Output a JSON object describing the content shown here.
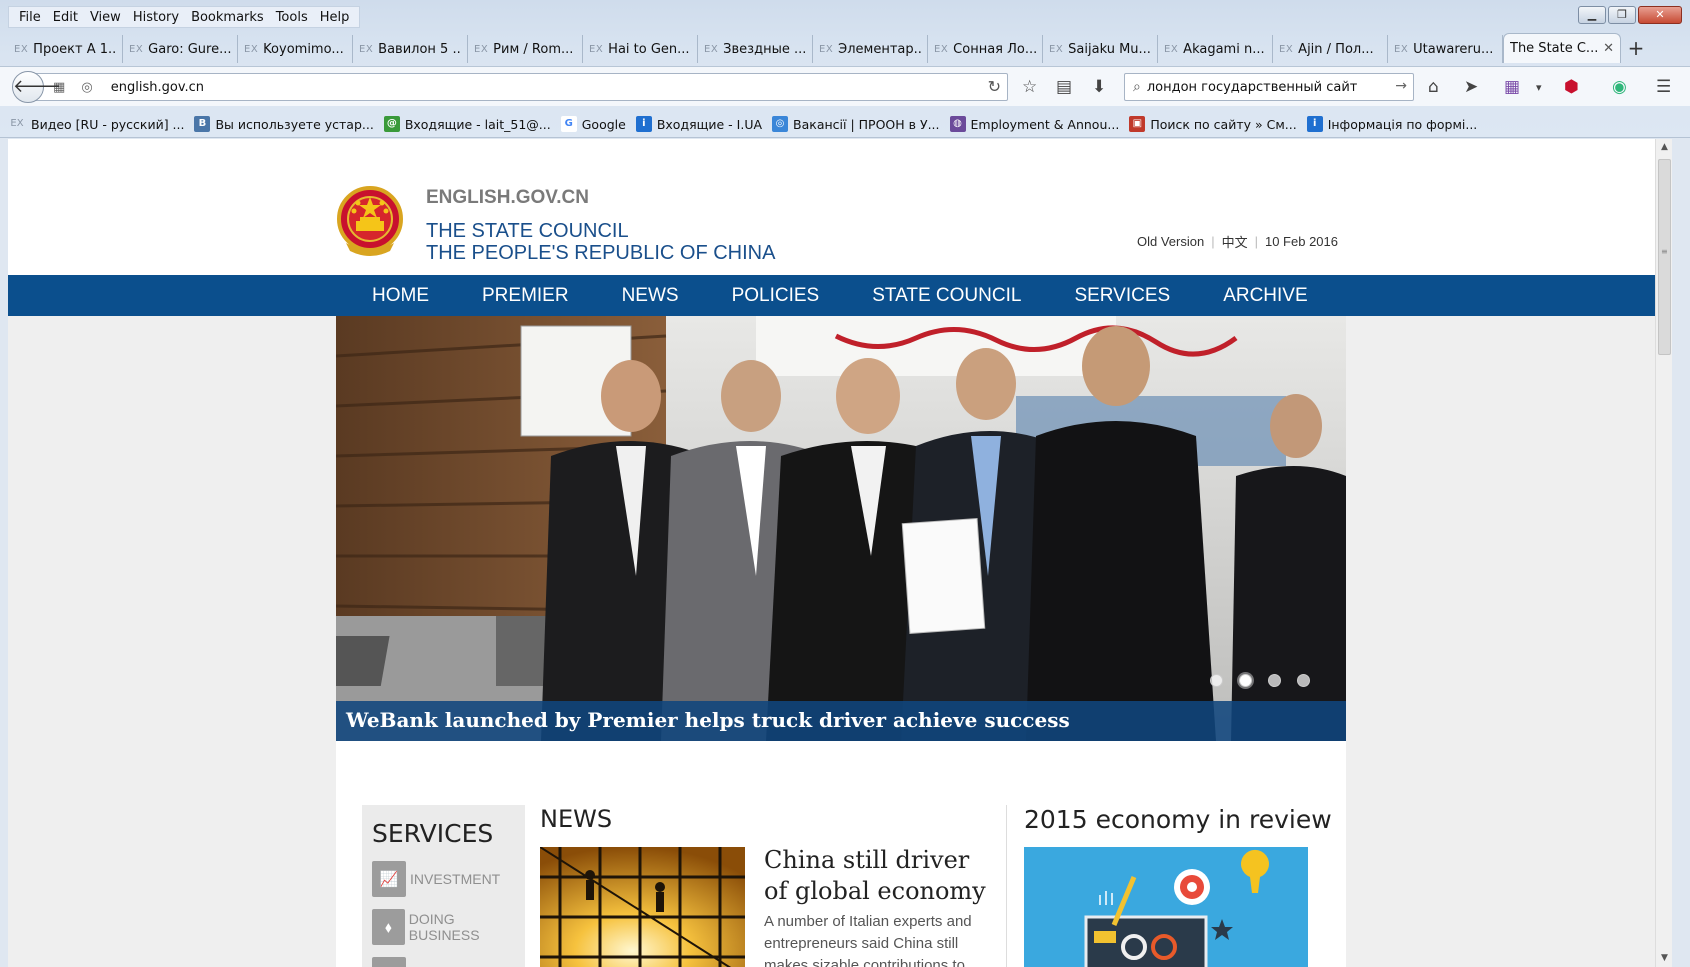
{
  "menubar": [
    "File",
    "Edit",
    "View",
    "History",
    "Bookmarks",
    "Tools",
    "Help"
  ],
  "tabs": [
    {
      "label": "Проект А 1...",
      "fav": "EX"
    },
    {
      "label": "Garo: Gure...",
      "fav": "EX"
    },
    {
      "label": "Koyomimo...",
      "fav": "EX"
    },
    {
      "label": "Вавилон 5 ...",
      "fav": "EX"
    },
    {
      "label": "Рим / Rom...",
      "fav": "EX"
    },
    {
      "label": "Hai to Gen...",
      "fav": "EX"
    },
    {
      "label": "Звездные ...",
      "fav": "EX"
    },
    {
      "label": "Элементар...",
      "fav": "EX"
    },
    {
      "label": "Сонная Ло...",
      "fav": "EX"
    },
    {
      "label": "Saijaku Mu...",
      "fav": "EX"
    },
    {
      "label": "Akagami n...",
      "fav": "EX"
    },
    {
      "label": "Ajin / Пол...",
      "fav": "EX"
    },
    {
      "label": "Utawareru...",
      "fav": "EX"
    }
  ],
  "active_tab": {
    "label": "The State C...",
    "close": "✕"
  },
  "new_tab": "+",
  "address": {
    "url": "english.gov.cn"
  },
  "search": {
    "value": "лондон государственный сайт"
  },
  "bookmarks": [
    {
      "label": "Видео [RU - русский] ...",
      "icon": "EX",
      "color": "#9aa6b4"
    },
    {
      "label": "Вы используете устар...",
      "icon": "B",
      "color": "#4a76a8"
    },
    {
      "label": "Входящие - lait_51@...",
      "icon": "@",
      "color": "#3a9a3a"
    },
    {
      "label": "Google",
      "icon": "G",
      "color": "#ffffff"
    },
    {
      "label": "Входящие - I.UA",
      "icon": "i",
      "color": "#1f6fd0"
    },
    {
      "label": "Вакансії | ПРООН в У...",
      "icon": "◎",
      "color": "#3a86d8"
    },
    {
      "label": "Employment & Annou...",
      "icon": "◍",
      "color": "#6b4a9a"
    },
    {
      "label": "Поиск по сайту » См...",
      "icon": "▣",
      "color": "#c0392b"
    },
    {
      "label": "Інформація по формі...",
      "icon": "i",
      "color": "#1f6fd0"
    }
  ],
  "site": {
    "domain": "ENGLISH.GOV.CN",
    "title_line1": "THE STATE COUNCIL",
    "title_line2": "THE PEOPLE'S REPUBLIC OF CHINA",
    "old_version": "Old Version",
    "chinese": "中文",
    "date": "10 Feb 2016"
  },
  "nav": [
    "HOME",
    "PREMIER",
    "NEWS",
    "POLICIES",
    "STATE COUNCIL",
    "SERVICES",
    "ARCHIVE"
  ],
  "hero": {
    "caption": "WeBank launched by Premier helps truck driver achieve success",
    "slide_count": 4,
    "active_slide": 2
  },
  "services": {
    "title": "SERVICES",
    "items": [
      {
        "label": "INVESTMENT",
        "icon": "chart-icon"
      },
      {
        "label": "DOING BUSINESS",
        "icon": "tag-icon"
      }
    ]
  },
  "news": {
    "title": "NEWS",
    "headline": "China still driver of global economy",
    "summary": "A number of Italian experts and entrepreneurs said China still makes sizable contributions to"
  },
  "review": {
    "title": "2015 economy in review"
  },
  "colors": {
    "nav_bg": "#0b4f8d",
    "title_blue": "#1a4f8b",
    "caption_bar": "#10467d"
  }
}
